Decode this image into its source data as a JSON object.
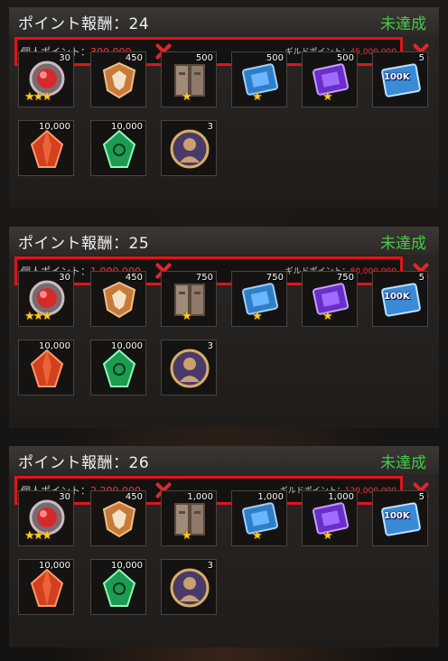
{
  "panels": [
    {
      "title": "ポイント報酬：24",
      "status": "未達成",
      "personal_label": "個人ポイント：",
      "personal_value": "300,000",
      "guild_label": "ギルドポイント：",
      "guild_value": "45,000,000",
      "items": [
        {
          "icon": "red-gem-medal-icon",
          "qty": "30",
          "stars": 3
        },
        {
          "icon": "winged-emblem-icon",
          "qty": "450",
          "stars": 0
        },
        {
          "icon": "stone-tablet-icon",
          "qty": "500",
          "stars": 1
        },
        {
          "icon": "blue-chip-icon",
          "qty": "500",
          "stars": 1
        },
        {
          "icon": "purple-chip-icon",
          "qty": "500",
          "stars": 1
        },
        {
          "icon": "cash-card-icon",
          "qty": "5",
          "stars": 0,
          "label": "100K"
        },
        {
          "icon": "red-crystal-icon",
          "qty": "10,000",
          "stars": 0
        },
        {
          "icon": "green-crystal-icon",
          "qty": "10,000",
          "stars": 0
        },
        {
          "icon": "hero-medal-icon",
          "qty": "3",
          "stars": 0
        }
      ]
    },
    {
      "title": "ポイント報酬：25",
      "status": "未達成",
      "personal_label": "個人ポイント：",
      "personal_value": "1,000,000",
      "guild_label": "ギルドポイント：",
      "guild_value": "80,000,000",
      "items": [
        {
          "icon": "red-gem-medal-icon",
          "qty": "30",
          "stars": 3
        },
        {
          "icon": "winged-emblem-icon",
          "qty": "450",
          "stars": 0
        },
        {
          "icon": "stone-tablet-icon",
          "qty": "750",
          "stars": 1
        },
        {
          "icon": "blue-chip-icon",
          "qty": "750",
          "stars": 1
        },
        {
          "icon": "purple-chip-icon",
          "qty": "750",
          "stars": 1
        },
        {
          "icon": "cash-card-icon",
          "qty": "5",
          "stars": 0,
          "label": "100K"
        },
        {
          "icon": "red-crystal-icon",
          "qty": "10,000",
          "stars": 0
        },
        {
          "icon": "green-crystal-icon",
          "qty": "10,000",
          "stars": 0
        },
        {
          "icon": "hero-medal-icon",
          "qty": "3",
          "stars": 0
        }
      ]
    },
    {
      "title": "ポイント報酬：26",
      "status": "未達成",
      "personal_label": "個人ポイント：",
      "personal_value": "2,200,000",
      "guild_label": "ギルドポイント：",
      "guild_value": "120,000,000",
      "items": [
        {
          "icon": "red-gem-medal-icon",
          "qty": "30",
          "stars": 3
        },
        {
          "icon": "winged-emblem-icon",
          "qty": "450",
          "stars": 0
        },
        {
          "icon": "stone-tablet-icon",
          "qty": "1,000",
          "stars": 1
        },
        {
          "icon": "blue-chip-icon",
          "qty": "1,000",
          "stars": 1
        },
        {
          "icon": "purple-chip-icon",
          "qty": "1,000",
          "stars": 1
        },
        {
          "icon": "cash-card-icon",
          "qty": "5",
          "stars": 0,
          "label": "100K"
        },
        {
          "icon": "red-crystal-icon",
          "qty": "10,000",
          "stars": 0
        },
        {
          "icon": "green-crystal-icon",
          "qty": "10,000",
          "stars": 0
        },
        {
          "icon": "hero-medal-icon",
          "qty": "3",
          "stars": 0
        }
      ]
    }
  ],
  "colors": {
    "status_incomplete": "#44cc44",
    "requirement_value": "#ff3030",
    "highlight_border": "#e0141b",
    "star": "#ffcc22"
  }
}
